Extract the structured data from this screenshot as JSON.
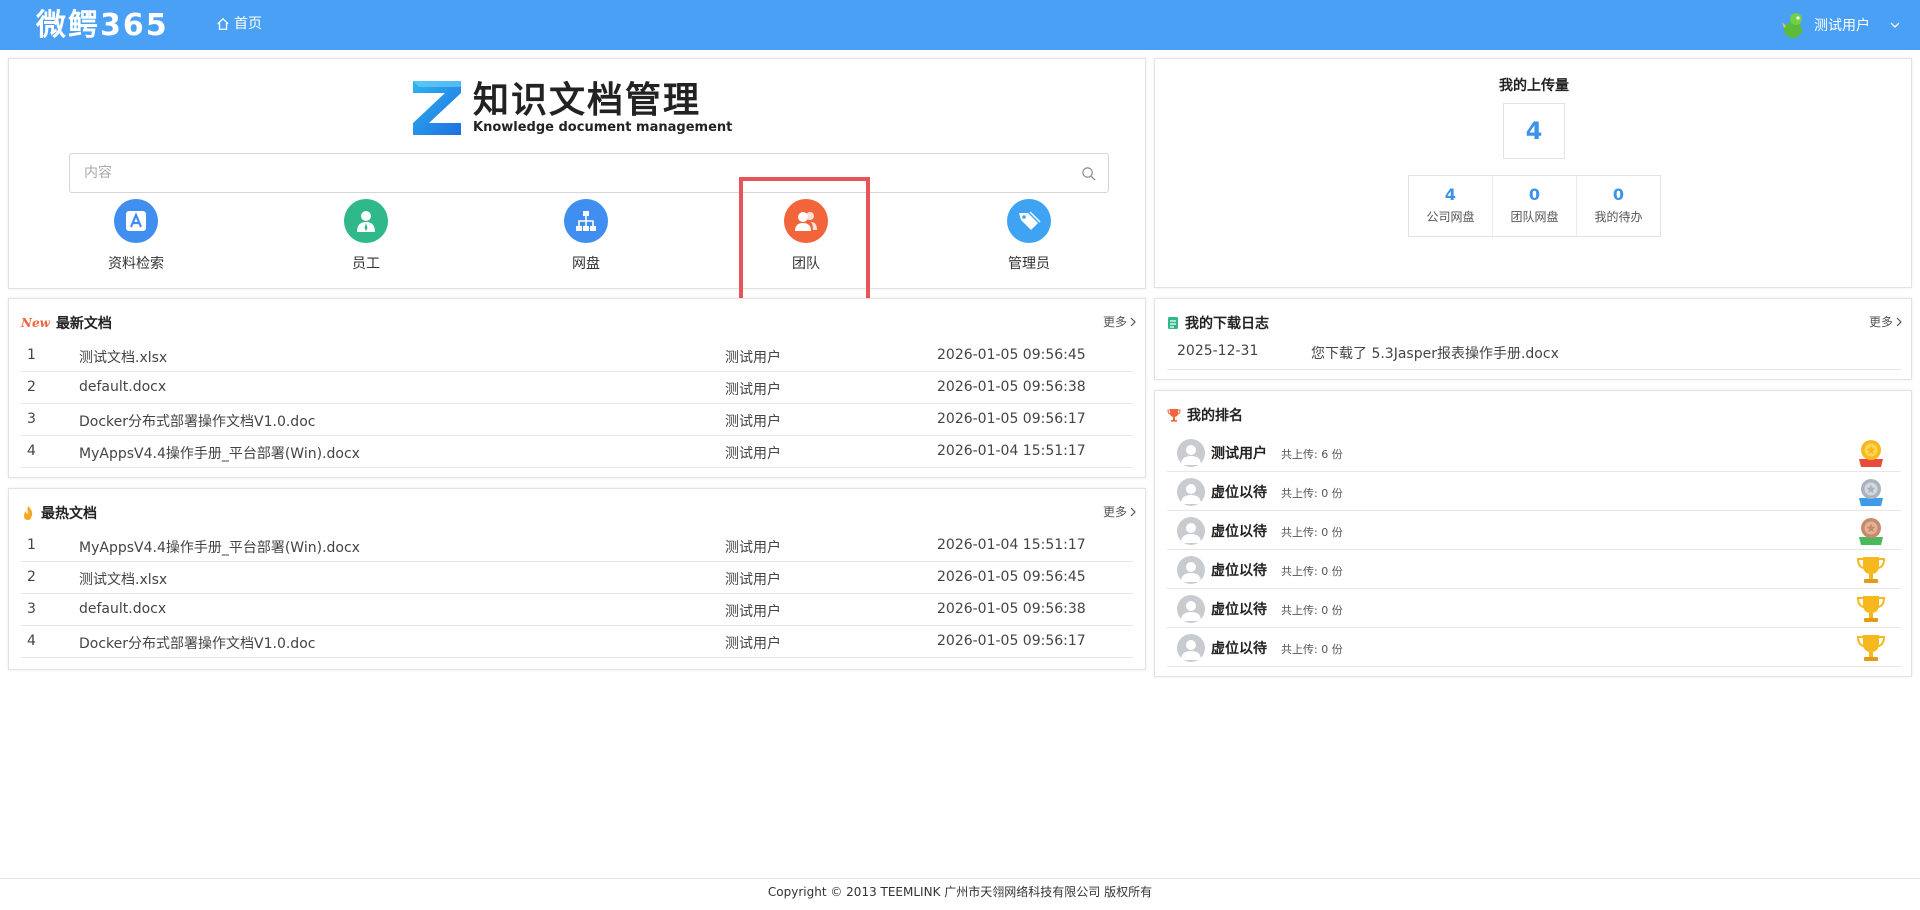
{
  "header": {
    "brand": "微鳄365",
    "home_label": "首页",
    "user_name": "测试用户",
    "bg_color": "#4aa0f5"
  },
  "search_panel": {
    "logo_title": "知识文档管理",
    "logo_subtitle": "Knowledge document management",
    "search_placeholder": "内容",
    "quick_links": [
      {
        "label": "资料检索",
        "icon": "retrieval-icon",
        "color": "#3f8ef0"
      },
      {
        "label": "员工",
        "icon": "employee-icon",
        "color": "#2fb88a"
      },
      {
        "label": "网盘",
        "icon": "network-disk-icon",
        "color": "#3f8ef0"
      },
      {
        "label": "团队",
        "icon": "team-icon",
        "color": "#f2643a"
      },
      {
        "label": "管理员",
        "icon": "admin-icon",
        "color": "#3fa3f3"
      }
    ]
  },
  "upload_panel": {
    "title": "我的上传量",
    "total": "4",
    "stats": [
      {
        "value": "4",
        "label": "公司网盘"
      },
      {
        "value": "0",
        "label": "团队网盘"
      },
      {
        "value": "0",
        "label": "我的待办"
      }
    ]
  },
  "latest_docs": {
    "badge": "New",
    "title": "最新文档",
    "more": "更多",
    "rows": [
      {
        "idx": "1",
        "name": "测试文档.xlsx",
        "user": "测试用户",
        "time": "2026-01-05 09:56:45"
      },
      {
        "idx": "2",
        "name": "default.docx",
        "user": "测试用户",
        "time": "2026-01-05 09:56:38"
      },
      {
        "idx": "3",
        "name": "Docker分布式部署操作文档V1.0.doc",
        "user": "测试用户",
        "time": "2026-01-05 09:56:17"
      },
      {
        "idx": "4",
        "name": "MyAppsV4.4操作手册_平台部署(Win).docx",
        "user": "测试用户",
        "time": "2026-01-04 15:51:17"
      }
    ]
  },
  "hot_docs": {
    "title": "最热文档",
    "more": "更多",
    "rows": [
      {
        "idx": "1",
        "name": "MyAppsV4.4操作手册_平台部署(Win).docx",
        "user": "测试用户",
        "time": "2026-01-04 15:51:17"
      },
      {
        "idx": "2",
        "name": "测试文档.xlsx",
        "user": "测试用户",
        "time": "2026-01-05 09:56:45"
      },
      {
        "idx": "3",
        "name": "default.docx",
        "user": "测试用户",
        "time": "2026-01-05 09:56:38"
      },
      {
        "idx": "4",
        "name": "Docker分布式部署操作文档V1.0.doc",
        "user": "测试用户",
        "time": "2026-01-05 09:56:17"
      }
    ]
  },
  "download_log": {
    "title": "我的下载日志",
    "more": "更多",
    "rows": [
      {
        "date": "2025-12-31",
        "text": "您下载了 5.3Jasper报表操作手册.docx"
      }
    ]
  },
  "ranking": {
    "title": "我的排名",
    "rows": [
      {
        "name": "测试用户",
        "count": "共上传: 6 份",
        "badge": "gold-medal-icon"
      },
      {
        "name": "虚位以待",
        "count": "共上传: 0 份",
        "badge": "silver-medal-icon"
      },
      {
        "name": "虚位以待",
        "count": "共上传: 0 份",
        "badge": "bronze-medal-icon"
      },
      {
        "name": "虚位以待",
        "count": "共上传: 0 份",
        "badge": "trophy-icon"
      },
      {
        "name": "虚位以待",
        "count": "共上传: 0 份",
        "badge": "trophy-icon"
      },
      {
        "name": "虚位以待",
        "count": "共上传: 0 份",
        "badge": "trophy-icon"
      }
    ]
  },
  "footer": {
    "text": "Copyright © 2013 TEEMLINK 广州市天翎网络科技有限公司 版权所有"
  }
}
